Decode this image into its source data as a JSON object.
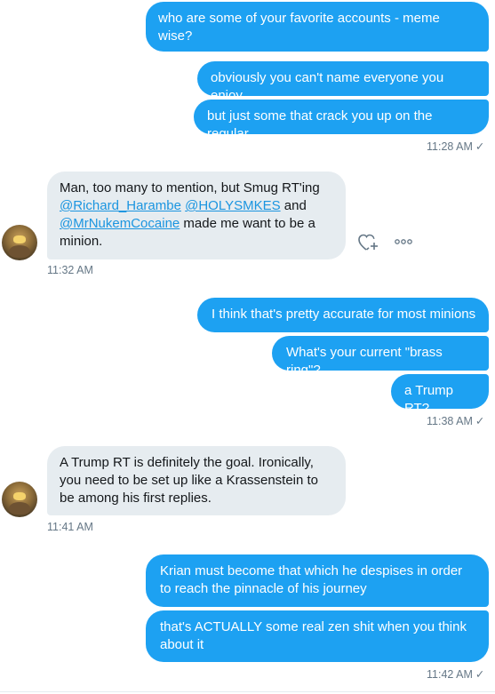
{
  "messages": {
    "m1": "who are some of your favorite accounts - meme wise?",
    "m2": "obviously you can't name everyone you enjoy",
    "m3": "but just some that crack you up on the regular",
    "t1": "11:28 AM",
    "m4_pre": "Man, too many to mention, but Smug RT'ing ",
    "m4_mention1": "@Richard_Harambe",
    "m4_sep": " ",
    "m4_mention2": "@HOLYSMKES",
    "m4_and": " and ",
    "m4_mention3": "@MrNukemCocaine",
    "m4_post": " made me want to be a minion.",
    "t2": "11:32 AM",
    "m5": "I think that's pretty accurate for most minions",
    "m6": "What's your current \"brass ring\"?",
    "m7": "a Trump RT?",
    "t3": "11:38 AM",
    "m8": "A Trump RT is definitely the goal.   Ironically, you need to be set up like a Krassenstein to be among his first replies.",
    "t4": "11:41 AM",
    "m9": "Krian must become that which he despises in order to reach the pinnacle of his journey",
    "m10": "that's ACTUALLY some real zen shit when you think about it",
    "t5": "11:42 AM",
    "check": "✓"
  },
  "icons": {
    "like": "heart-plus-icon",
    "more": "more-icon"
  },
  "colors": {
    "outgoing": "#1da1f2",
    "incoming": "#e6ecf0",
    "mention": "#1b95e0",
    "timestamp": "#657786"
  }
}
